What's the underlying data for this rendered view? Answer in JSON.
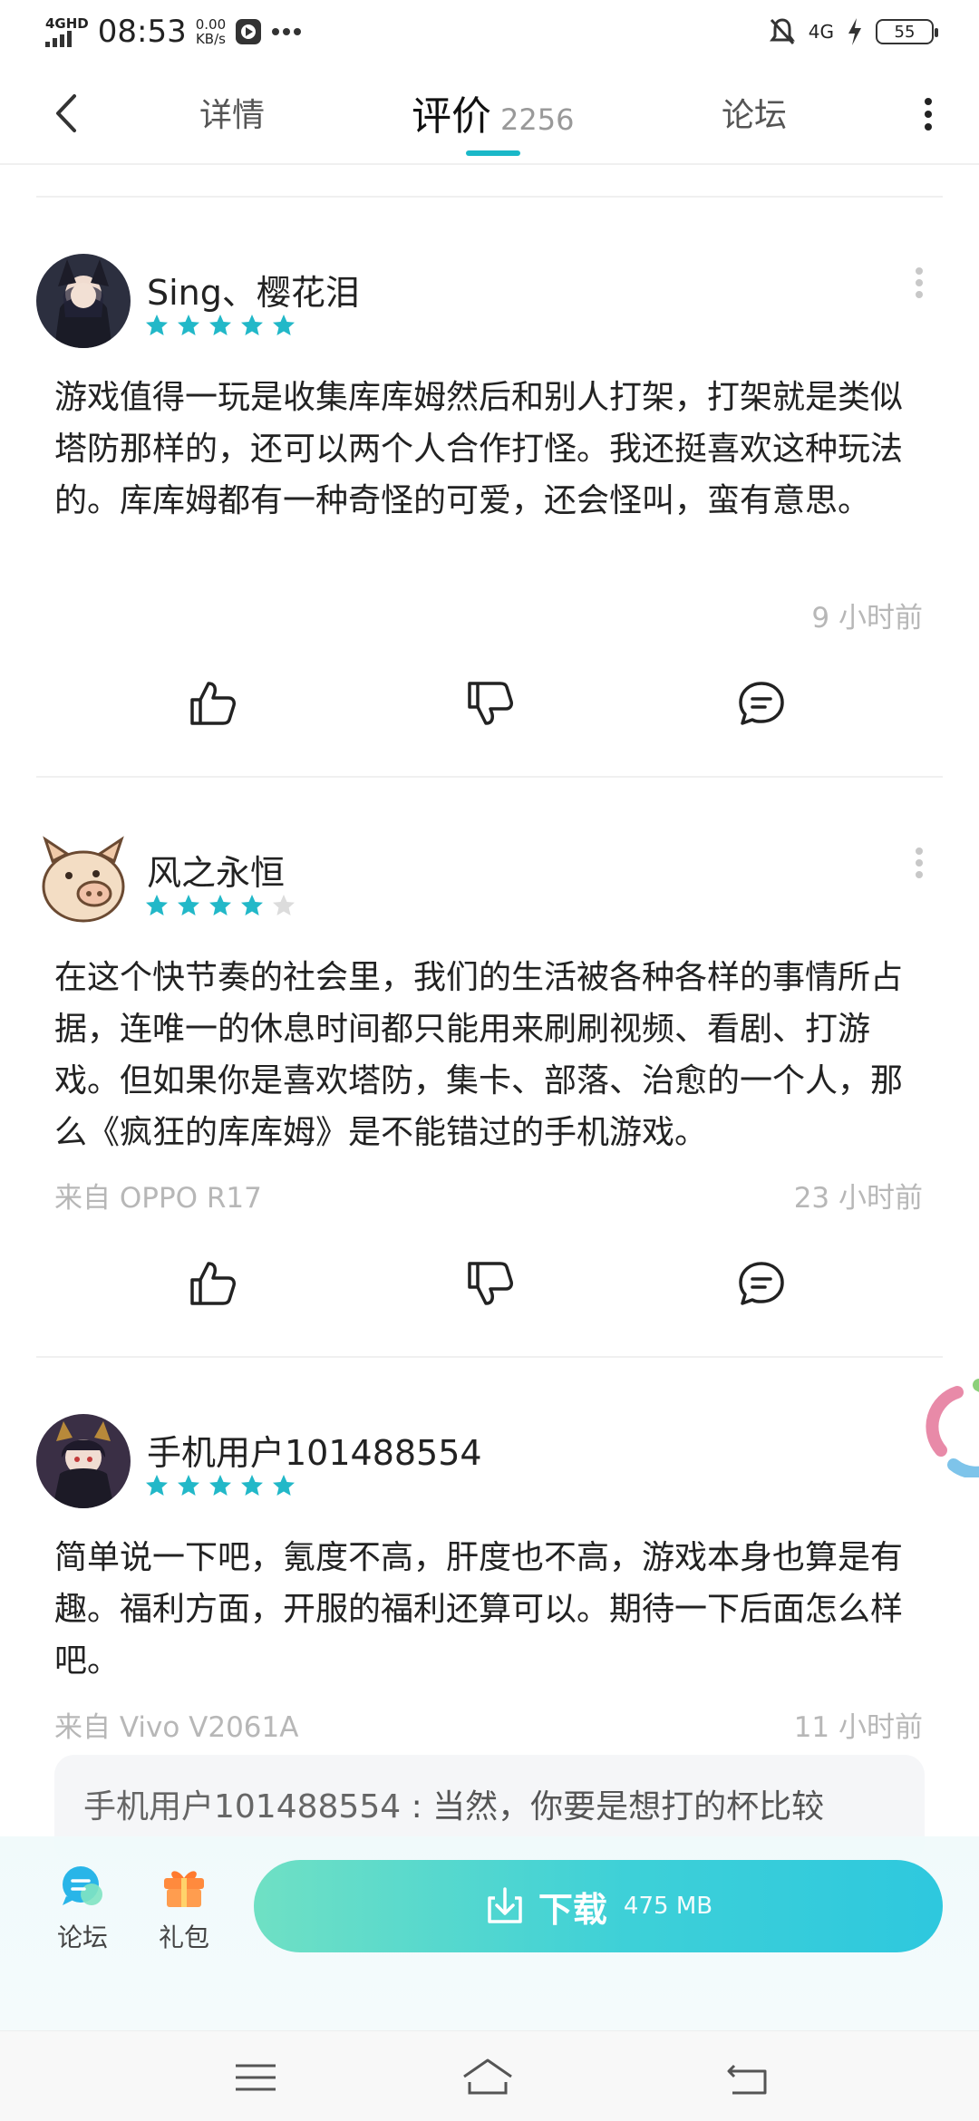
{
  "status": {
    "network": "4GHD",
    "time": "08:53",
    "speed_value": "0.00",
    "speed_unit": "KB/s",
    "net2": "4G",
    "battery": "55"
  },
  "nav": {
    "tabs": [
      {
        "label": "详情"
      },
      {
        "label": "评价",
        "count": "2256"
      },
      {
        "label": "论坛"
      }
    ]
  },
  "reviews": [
    {
      "user": "Sing、樱花泪",
      "rating": 5,
      "text": "游戏值得一玩是收集库库姆然后和别人打架，打架就是类似塔防那样的，还可以两个人合作打怪。我还挺喜欢这种玩法的。库库姆都有一种奇怪的可爱，还会怪叫，蛮有意思。",
      "device": "",
      "time": "9 小时前"
    },
    {
      "user": "风之永恒",
      "rating": 4,
      "text": "在这个快节奏的社会里，我们的生活被各种各样的事情所占据，连唯一的休息时间都只能用来刷刷视频、看剧、打游戏。但如果你是喜欢塔防，集卡、部落、治愈的一个人，那么《疯狂的库库姆》是不能错过的手机游戏。",
      "device": "来自 OPPO R17",
      "time": "23 小时前"
    },
    {
      "user": "手机用户101488554",
      "rating": 5,
      "text": "简单说一下吧，氪度不高，肝度也不高，游戏本身也算是有趣。福利方面，开服的福利还算可以。期待一下后面怎么样吧。",
      "device": "来自 Vivo V2061A",
      "time": "11 小时前",
      "reply": {
        "user": "手机用户101488554",
        "text": "当然，你要是想打的杯比较"
      }
    }
  ],
  "bottom": {
    "forum_label": "论坛",
    "gift_label": "礼包",
    "download_label": "下载",
    "download_size": "475 MB"
  },
  "colors": {
    "accent": "#1ab8c8",
    "star": "#22b8c8",
    "star_empty": "#dcdcdc"
  }
}
